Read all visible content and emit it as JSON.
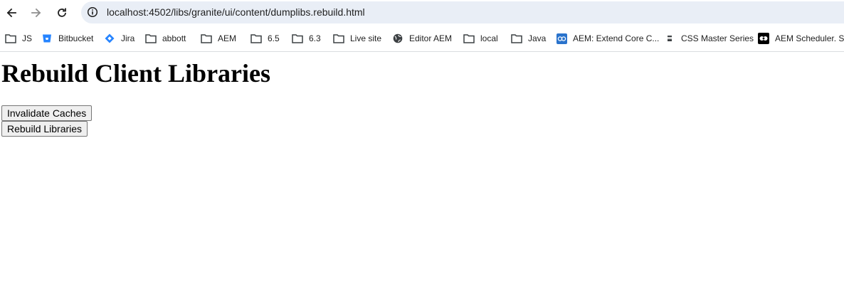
{
  "browser": {
    "url": "localhost:4502/libs/granite/ui/content/dumplibs.rebuild.html",
    "bookmarks": [
      {
        "label": "JS",
        "icon": "folder-icon"
      },
      {
        "label": "Bitbucket",
        "icon": "bitbucket-icon"
      },
      {
        "label": "Jira",
        "icon": "jira-icon"
      },
      {
        "label": "abbott",
        "icon": "folder-icon"
      },
      {
        "label": "AEM",
        "icon": "folder-icon"
      },
      {
        "label": "6.5",
        "icon": "folder-icon"
      },
      {
        "label": "6.3",
        "icon": "folder-icon"
      },
      {
        "label": "Live site",
        "icon": "folder-icon"
      },
      {
        "label": "Editor AEM",
        "icon": "globe-icon"
      },
      {
        "label": "local",
        "icon": "folder-icon"
      },
      {
        "label": "Java",
        "icon": "folder-icon"
      },
      {
        "label": "AEM: Extend Core C...",
        "icon": "coursera-icon"
      },
      {
        "label": "CSS Master Series",
        "icon": "css-icon"
      },
      {
        "label": "AEM Scheduler. Sc",
        "icon": "scheduler-icon"
      }
    ]
  },
  "page": {
    "title": "Rebuild Client Libraries",
    "invalidate_button": "Invalidate Caches",
    "rebuild_button": "Rebuild Libraries"
  },
  "colors": {
    "omnibox_bg": "#e9eef6",
    "bitbucket": "#2684ff",
    "jira": "#2684ff",
    "coursera": "#2a73cc"
  }
}
